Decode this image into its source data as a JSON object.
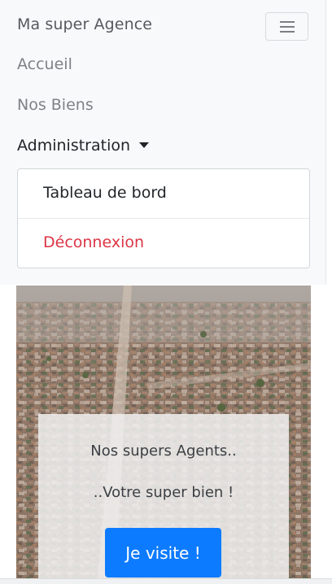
{
  "navbar": {
    "brand": "Ma super Agence",
    "toggler_icon": "hamburger-icon",
    "links": [
      "Accueil",
      "Nos Biens"
    ],
    "dropdown_label": "Administration",
    "dropdown_items": [
      {
        "label": "Tableau de bord",
        "color": "#212529"
      },
      {
        "label": "Déconnexion",
        "color": "#dc3545"
      }
    ]
  },
  "hero": {
    "image": "aerial-city-photo",
    "tagline_1": "Nos supers Agents..",
    "tagline_2": "..Votre super bien !",
    "cta_label": "Je visite !",
    "cta_color": "#0d7bff"
  }
}
